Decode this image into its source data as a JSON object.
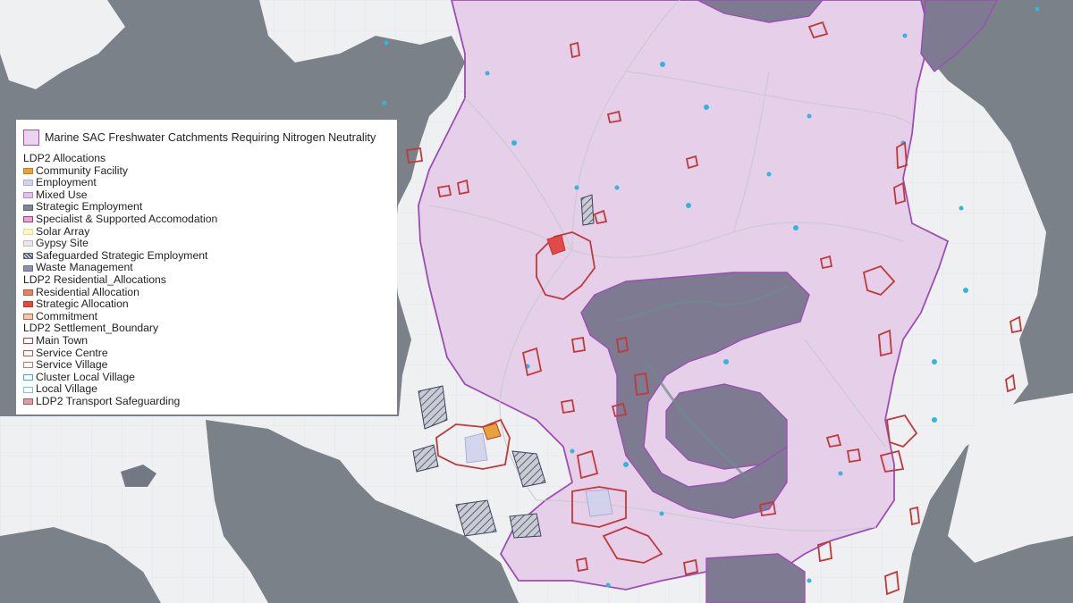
{
  "map": {
    "colors": {
      "sea": "#7b8189",
      "land": "#eef0f2",
      "catchment_fill": "#e6cfe9",
      "catchment_edge": "#9b4fb3",
      "estuary": "#7e7a92",
      "settlement_edge": "#c0393b",
      "strategic_fill": "#e04a4a",
      "water": "#34b5dc"
    },
    "legend": {
      "catchment": {
        "label": "Marine SAC Freshwater Catchments Requiring Nitrogen Neutrality",
        "fill": "#ecd3ee",
        "edge": "#a050b0"
      },
      "groups": [
        {
          "heading": "LDP2 Allocations",
          "items": [
            {
              "label": "Community Facility",
              "fill": "#e9a23b",
              "edge": "#c47a20"
            },
            {
              "label": "Employment",
              "fill": "#cfd3ec",
              "edge": "#a8aed6"
            },
            {
              "label": "Mixed Use",
              "fill": "#e2c4ea",
              "edge": "#b78ac6"
            },
            {
              "label": "Strategic Employment",
              "fill": "#7f8698",
              "edge": "#5b6274"
            },
            {
              "label": "Specialist & Supported Accomodation",
              "fill": "#e1a7d6",
              "edge": "#b0387f"
            },
            {
              "label": "Solar Array",
              "fill": "#fff6c8",
              "edge": "#e8d890"
            },
            {
              "label": "Gypsy Site",
              "fill": "#e8e8e8",
              "edge": "#bdbdbd"
            },
            {
              "label": "Safeguarded Strategic Employment",
              "fill": "hatch",
              "edge": "#5b6274"
            },
            {
              "label": "Waste Management",
              "fill": "#8d92a8",
              "edge": "#6c7189"
            }
          ]
        },
        {
          "heading": "LDP2 Residential_Allocations",
          "items": [
            {
              "label": "Residential Allocation",
              "fill": "#e08565",
              "edge": "#c25a3c"
            },
            {
              "label": "Strategic Allocation",
              "fill": "#e24b35",
              "edge": "#c0352a"
            },
            {
              "label": "Commitment",
              "fill": "#f2c6b0",
              "edge": "#c2623a"
            }
          ]
        },
        {
          "heading": "LDP2 Settlement_Boundary",
          "items": [
            {
              "label": "Main Town",
              "fill": "#ffffff",
              "edge": "#c0393b"
            },
            {
              "label": "Service Centre",
              "fill": "#ffffff",
              "edge": "#d15040"
            },
            {
              "label": "Service Village",
              "fill": "#ffffff",
              "edge": "#d86a56"
            },
            {
              "label": "Cluster Local Village",
              "fill": "#ffffff",
              "edge": "#35aee0"
            },
            {
              "label": "Local Village",
              "fill": "#ffffff",
              "edge": "#74c5e8"
            },
            {
              "label": "LDP2 Transport Safeguarding",
              "fill": "#d9a0a6",
              "edge": "#a85a64"
            }
          ]
        }
      ]
    }
  }
}
